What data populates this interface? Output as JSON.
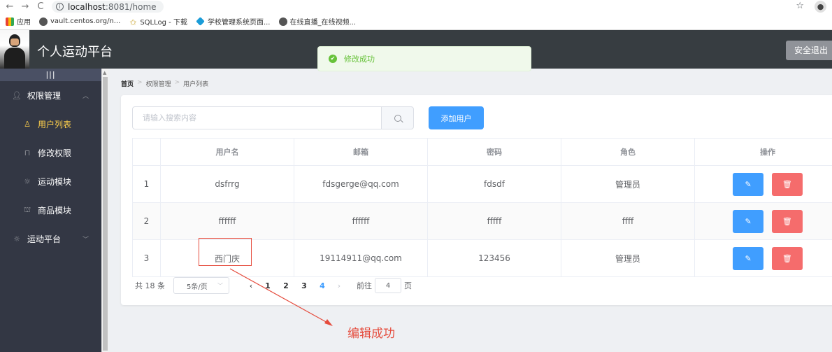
{
  "browser": {
    "url_host": "localhost",
    "url_rest": ":8081/home",
    "bookmarks": [
      "应用",
      "vault.centos.org/n...",
      "SQLLog - 下载",
      "学校管理系统页面...",
      "在线直播_在线视频..."
    ]
  },
  "header": {
    "title": "个人运动平台",
    "logout_label": "安全退出"
  },
  "toast": {
    "message": "修改成功",
    "color": "#67c23a"
  },
  "sidebar": {
    "collapse_label": "|||",
    "groups": [
      {
        "label": "权限管理",
        "icon": "user-icon",
        "items": [
          {
            "label": "用户列表",
            "icon": "person-icon",
            "active": true
          },
          {
            "label": "修改权限",
            "icon": "lock-icon"
          },
          {
            "label": "运动模块",
            "icon": "sun-icon"
          },
          {
            "label": "商品模块",
            "icon": "bag-icon"
          }
        ]
      },
      {
        "label": "运动平台",
        "icon": "sun-icon",
        "items": []
      }
    ]
  },
  "breadcrumb": [
    "首页",
    "权限管理",
    "用户列表"
  ],
  "search": {
    "placeholder": "请输入搜索内容",
    "value": ""
  },
  "add_user_label": "添加用户",
  "table": {
    "columns": [
      "",
      "用户名",
      "邮箱",
      "密码",
      "角色",
      "操作"
    ],
    "rows": [
      {
        "index": "1",
        "username": "dsfrrg",
        "email": "fdsgerge@qq.com",
        "password": "fdsdf",
        "role": "管理员"
      },
      {
        "index": "2",
        "username": "ffffff",
        "email": "ffffff",
        "password": "fffff",
        "role": "ffff"
      },
      {
        "index": "3",
        "username": "西门庆",
        "email": "19114911@qq.com",
        "password": "123456",
        "role": "管理员"
      }
    ]
  },
  "pagination": {
    "total_label": "共 18 条",
    "page_size": "5条/页",
    "pages": [
      "1",
      "2",
      "3",
      "4"
    ],
    "current_page": "4",
    "goto_label": "前往",
    "goto_value": "4",
    "page_suffix": "页"
  },
  "annotation": {
    "text": "编辑成功",
    "color": "#e54b3c"
  }
}
